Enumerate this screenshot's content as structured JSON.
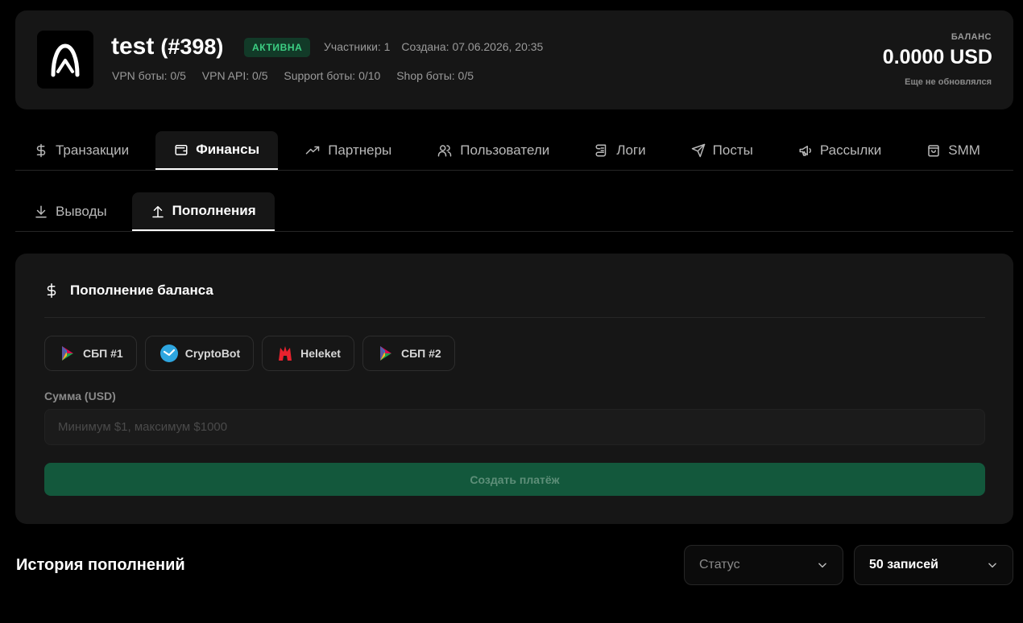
{
  "project": {
    "name": "test",
    "id_label": "(#398)",
    "status": "АКТИВНА",
    "participants": "Участники: 1",
    "created": "Создана: 07.06.2026, 20:35",
    "limits": [
      "VPN боты: 0/5",
      "VPN API: 0/5",
      "Support боты: 0/10",
      "Shop боты: 0/5"
    ]
  },
  "balance": {
    "label": "БАЛАНС",
    "value": "0.0000 USD",
    "note": "Еще не обновлялся"
  },
  "main_tabs": [
    {
      "label": "Транзакции",
      "icon": "dollar-icon"
    },
    {
      "label": "Финансы",
      "icon": "wallet-icon",
      "active": true
    },
    {
      "label": "Партнеры",
      "icon": "trending-up-icon"
    },
    {
      "label": "Пользователи",
      "icon": "users-icon"
    },
    {
      "label": "Логи",
      "icon": "scroll-icon"
    },
    {
      "label": "Посты",
      "icon": "send-icon"
    },
    {
      "label": "Рассылки",
      "icon": "megaphone-icon"
    },
    {
      "label": "SMM",
      "icon": "shopping-bag-icon"
    }
  ],
  "sub_tabs": [
    {
      "label": "Выводы",
      "icon": "download-icon"
    },
    {
      "label": "Пополнения",
      "icon": "upload-icon",
      "active": true
    }
  ],
  "topup": {
    "title": "Пополнение баланса",
    "methods": [
      {
        "label": "СБП #1",
        "icon": "sbp-icon"
      },
      {
        "label": "CryptoBot",
        "icon": "cryptobot-icon"
      },
      {
        "label": "Heleket",
        "icon": "heleket-icon"
      },
      {
        "label": "СБП #2",
        "icon": "sbp-icon"
      }
    ],
    "amount_label": "Сумма (USD)",
    "amount_value": "",
    "amount_placeholder": "Минимум $1, максимум $1000",
    "submit_label": "Создать платёж"
  },
  "history": {
    "title": "История пополнений",
    "status_select": "Статус",
    "limit_select": "50 записей"
  },
  "colors": {
    "accent_green": "#13583c",
    "status_text": "#3ccf83",
    "card_bg": "#161616"
  }
}
